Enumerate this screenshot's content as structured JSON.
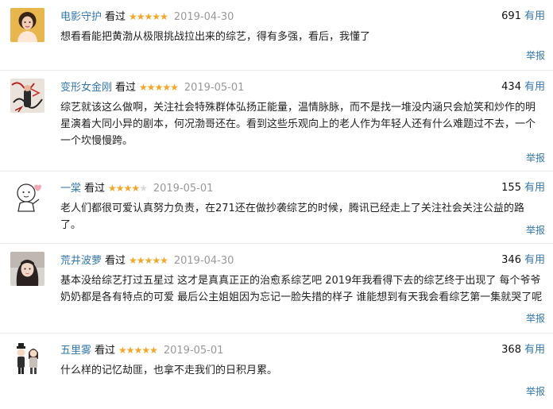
{
  "colors": {
    "link": "#3377aa",
    "star": "#f5a623",
    "date": "#999999",
    "divider": "#e9e9e9"
  },
  "comments": [
    {
      "user": "电影守护",
      "status": "看过",
      "rating": 5,
      "date": "2019-04-30",
      "votes": "691",
      "vote_label": "有用",
      "text": "想看看能把黄渤从极限挑战拉出来的综艺，得有多强，看后，我懂了",
      "report": "举报",
      "avatar": "avatar-gold-portrait"
    },
    {
      "user": "变形女金刚",
      "status": "看过",
      "rating": 5,
      "date": "2019-05-01",
      "votes": "434",
      "vote_label": "有用",
      "text": "综艺就该这么做啊，关注社会特殊群体弘扬正能量，温情脉脉，而不是找一堆没内涵只会尬笑和炒作的明星演着大同小异的剧本，何况渤哥还在。看到这些乐观向上的老人作为年轻人还有什么难题过不去，一个一个坎慢慢跨。",
      "report": "举报",
      "avatar": "avatar-graffiti-wall"
    },
    {
      "user": "一棠",
      "status": "看过",
      "rating": 4,
      "date": "2019-05-01",
      "votes": "155",
      "vote_label": "有用",
      "text": "老人们都很可爱认真努力负责，在271还在做抄袭综艺的时候，腾讯已经走上了关注社会关注公益的路了。",
      "report": "举报",
      "avatar": "avatar-cartoon-doodle"
    },
    {
      "user": "荒井波萝",
      "status": "看过",
      "rating": 5,
      "date": "2019-04-30",
      "votes": "346",
      "vote_label": "有用",
      "text": "基本没给综艺打过五星过 这才是真真正正的治愈系综艺吧 2019年我看得下去的综艺终于出现了 每个爷爷奶奶都是各有特点的可爱 最后公主姐姐因为忘记一脸失措的样子 谁能想到有天我会看综艺第一集就哭了呢",
      "report": "举报",
      "avatar": "avatar-girl-photo"
    },
    {
      "user": "五里雾",
      "status": "看过",
      "rating": 5,
      "date": "2019-05-01",
      "votes": "368",
      "vote_label": "有用",
      "text": "什么样的记忆劫匪，也拿不走我们的日积月累。",
      "report": "举报",
      "avatar": "avatar-couple-cartoon"
    }
  ]
}
